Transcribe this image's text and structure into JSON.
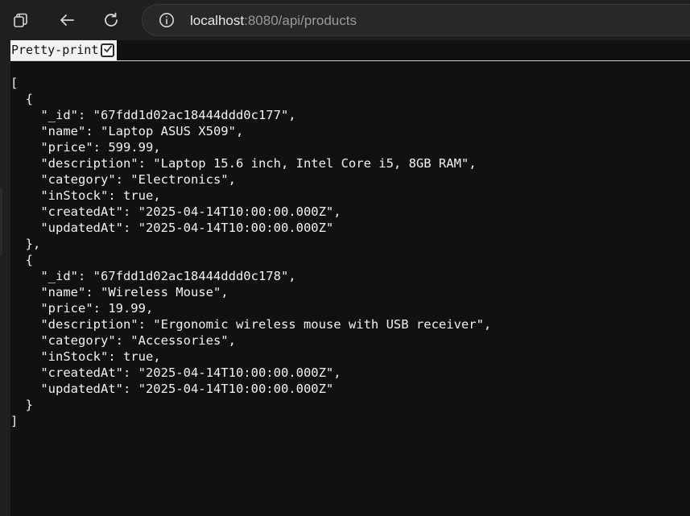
{
  "browser": {
    "url_host": "localhost",
    "url_rest": ":8080/api/products"
  },
  "viewer": {
    "pretty_print_label": "Pretty-print",
    "pretty_print_checked": true,
    "json_text": "[\n  {\n    \"_id\": \"67fdd1d02ac18444ddd0c177\",\n    \"name\": \"Laptop ASUS X509\",\n    \"price\": 599.99,\n    \"description\": \"Laptop 15.6 inch, Intel Core i5, 8GB RAM\",\n    \"category\": \"Electronics\",\n    \"inStock\": true,\n    \"createdAt\": \"2025-04-14T10:00:00.000Z\",\n    \"updatedAt\": \"2025-04-14T10:00:00.000Z\"\n  },\n  {\n    \"_id\": \"67fdd1d02ac18444ddd0c178\",\n    \"name\": \"Wireless Mouse\",\n    \"price\": 19.99,\n    \"description\": \"Ergonomic wireless mouse with USB receiver\",\n    \"category\": \"Accessories\",\n    \"inStock\": true,\n    \"createdAt\": \"2025-04-14T10:00:00.000Z\",\n    \"updatedAt\": \"2025-04-14T10:00:00.000Z\"\n  }\n]"
  },
  "icons": {
    "tabs": "tab-actions-icon",
    "back": "back-arrow-icon",
    "reload": "reload-icon",
    "info": "site-info-icon",
    "check": "checkmark-icon"
  },
  "colors": {
    "chrome_bg": "#1f1f1f",
    "page_bg": "#111111",
    "text": "#f2f2f2",
    "url_secondary": "#9a9a9a"
  }
}
